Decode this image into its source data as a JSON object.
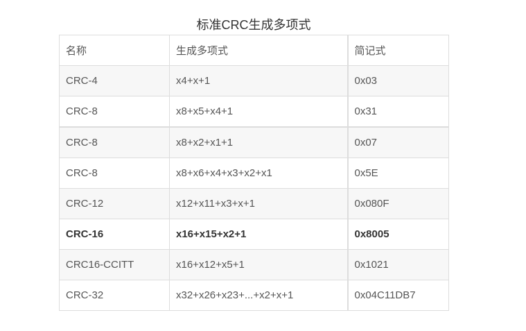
{
  "caption": "标准CRC生成多项式",
  "table": {
    "headers": [
      "名称",
      "生成多项式",
      "简记式"
    ],
    "rows": [
      {
        "name": "CRC-4",
        "polynomial": "x4+x+1",
        "short": "0x03",
        "bold": false
      },
      {
        "name": "CRC-8",
        "polynomial": "x8+x5+x4+1",
        "short": "0x31",
        "bold": false
      },
      {
        "name": "CRC-8",
        "polynomial": "x8+x2+x1+1",
        "short": "0x07",
        "bold": false
      },
      {
        "name": "CRC-8",
        "polynomial": "x8+x6+x4+x3+x2+x1",
        "short": "0x5E",
        "bold": false
      },
      {
        "name": "CRC-12",
        "polynomial": "x12+x11+x3+x+1",
        "short": "0x080F",
        "bold": false
      },
      {
        "name": "CRC-16",
        "polynomial": "x16+x15+x2+1",
        "short": "0x8005",
        "bold": true
      },
      {
        "name": "CRC16-CCITT",
        "polynomial": "x16+x12+x5+1",
        "short": "0x1021",
        "bold": false
      },
      {
        "name": "CRC-32",
        "polynomial": "x32+x26+x23+...+x2+x+1",
        "short": "0x04C11DB7",
        "bold": false
      }
    ]
  }
}
